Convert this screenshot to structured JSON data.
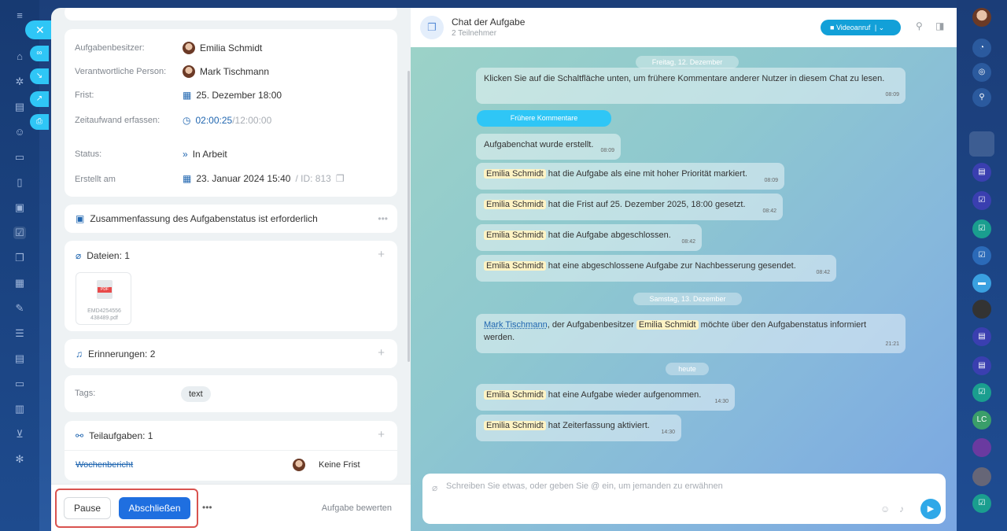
{
  "task": {
    "fields": {
      "owner_label": "Aufgabenbesitzer:",
      "owner": "Emilia Schmidt",
      "responsible_label": "Verantwortliche Person:",
      "responsible": "Mark Tischmann",
      "deadline_label": "Frist:",
      "deadline": "25. Dezember 18:00",
      "time_label": "Zeitaufwand erfassen:",
      "time_spent": "02:00:25",
      "time_total": "/12:00:00",
      "status_label": "Status:",
      "status": "In Arbeit",
      "created_label": "Erstellt am",
      "created": "23. Januar 2024 15:40",
      "id_text": "/ ID: 813"
    },
    "summary": {
      "title": "Zusammenfassung des Aufgabenstatus ist erforderlich"
    },
    "files": {
      "title": "Dateien: 1",
      "file_name": "EMD4254556 438489.pdf",
      "file_badge": "PDF"
    },
    "reminders": {
      "title": "Erinnerungen: 2"
    },
    "tags": {
      "label": "Tags:",
      "tag": "text"
    },
    "subtasks": {
      "title": "Teilaufgaben: 1",
      "name": "Wochenbericht",
      "due": "Keine Frist"
    },
    "footer": {
      "pause": "Pause",
      "complete": "Abschließen",
      "more": "•••",
      "rate": "Aufgabe bewerten"
    }
  },
  "chat": {
    "title": "Chat der Aufgabe",
    "subtitle": "2 Teilnehmer",
    "video_button": "Videoanruf",
    "dates": {
      "d1": "Freitag, 12. Dezember",
      "d2": "Samstag, 13. Dezember",
      "d3": "heute"
    },
    "earlier_button": "Frühere Kommentare",
    "messages": {
      "m1": {
        "text": "Klicken Sie auf die Schaltfläche unten, um frühere Kommentare anderer Nutzer in diesem Chat zu lesen.",
        "time": "08:09"
      },
      "m2": {
        "text": "Aufgabenchat wurde erstellt.",
        "time": "08:09"
      },
      "m3": {
        "name": "Emilia Schmidt",
        "text": " hat die Aufgabe als eine mit hoher Priorität markiert.",
        "time": "08:09"
      },
      "m4": {
        "name": "Emilia Schmidt",
        "text": " hat die Frist auf 25. Dezember 2025, 18:00 gesetzt.",
        "time": "08:42"
      },
      "m5": {
        "name": "Emilia Schmidt",
        "text": " hat die Aufgabe abgeschlossen.",
        "time": "08:42"
      },
      "m6": {
        "name": "Emilia Schmidt",
        "text": " hat eine abgeschlossene Aufgabe zur Nachbesserung gesendet.",
        "time": "08:42"
      },
      "m7": {
        "name1": "Mark Tischmann",
        "text1": ", der Aufgabenbesitzer ",
        "name2": "Emilia Schmidt",
        "text2": " möchte über den Aufgabenstatus informiert werden.",
        "time": "21:21"
      },
      "m8": {
        "name": "Emilia Schmidt",
        "text": " hat eine Aufgabe wieder aufgenommen.",
        "time": "14:30"
      },
      "m9": {
        "name": "Emilia Schmidt",
        "text": " hat Zeiterfassung aktiviert.",
        "time": "14:30"
      }
    },
    "composer_placeholder": "Schreiben Sie etwas, oder geben Sie @ ein, um jemanden zu erwähnen"
  },
  "rightbar": {
    "badge": "LC"
  },
  "colors": {
    "accent": "#2fc6f6",
    "primary_button": "#1f6fe0",
    "highlight": "#d9534f",
    "name_chip": "#fff3c4"
  }
}
